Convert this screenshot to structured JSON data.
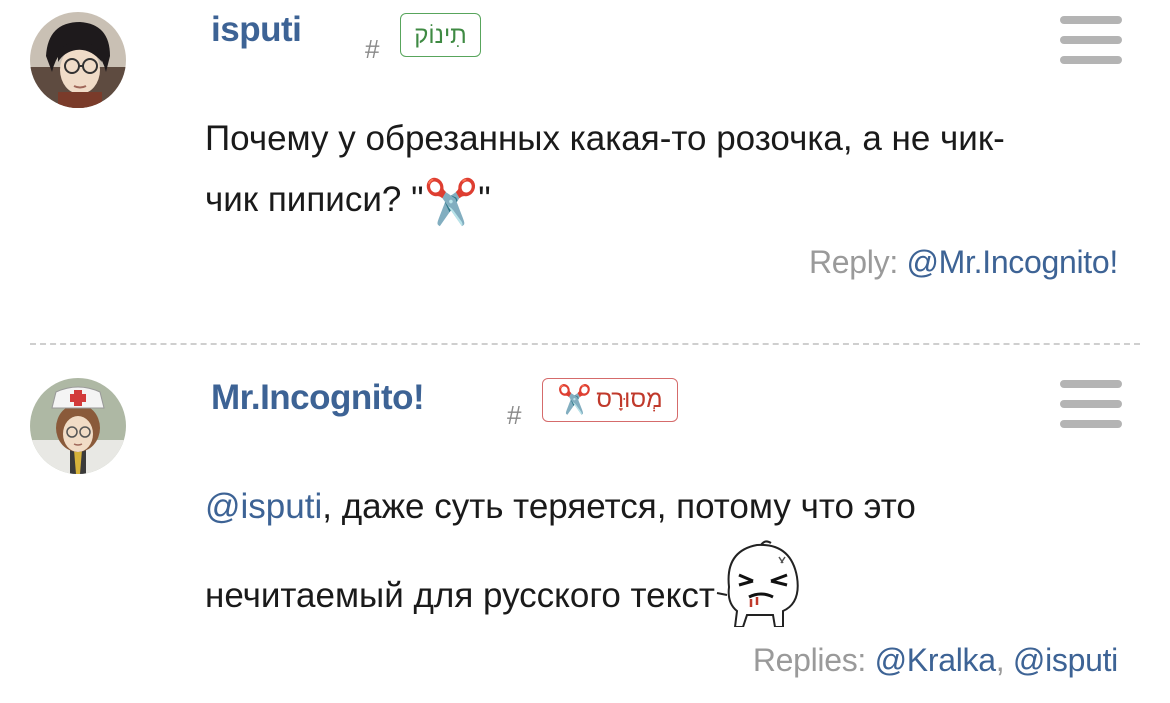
{
  "comments": [
    {
      "username": "isputi",
      "hash": "#",
      "badge": "תִינוֹק",
      "body_line1": "Почему у обрезанных какая-то розочка, а не чик-",
      "body_line2_prefix": "чик пиписи? \"",
      "body_line2_emoji": "✂️",
      "body_line2_suffix": "\"",
      "replies_label": "Reply: ",
      "replies": [
        "@Mr.Incognito!"
      ],
      "avatar_icon": "anime-character-glasses-avatar",
      "menu_icon": "hamburger-menu-icon"
    },
    {
      "username": "Mr.Incognito!",
      "hash": "#",
      "badge_emoji": "✂️",
      "badge": "מְסוּרָס",
      "mention": "@isputi",
      "body_line1_rest": ", даже суть теряется, потому что это",
      "body_line2": "нечитаемый для русского текст",
      "sticker_icon": "angry-blob-sticker",
      "replies_label": "Replies: ",
      "replies": [
        "@Kralka",
        "@isputi"
      ],
      "replies_separator": ", ",
      "avatar_icon": "anime-character-nurse-hat-avatar",
      "menu_icon": "hamburger-menu-icon"
    }
  ],
  "colors": {
    "username": "#3d6395",
    "badge_green": "#58a55c",
    "badge_red": "#d56b6b",
    "muted": "#9a9a9a",
    "menu": "#b4b4b4"
  }
}
